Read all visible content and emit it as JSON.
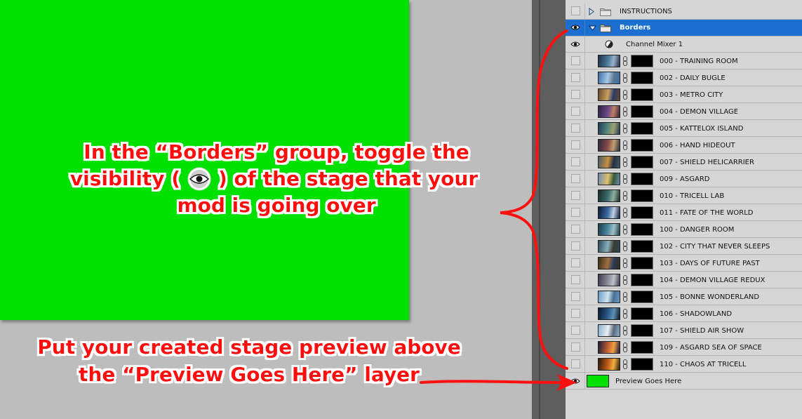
{
  "layers_panel": {
    "groups": [
      {
        "label": "INSTRUCTIONS",
        "expanded": false,
        "visible": false
      },
      {
        "label": "Borders",
        "expanded": true,
        "visible": true,
        "selected": true
      }
    ],
    "adjustment_layer": {
      "label": "Channel Mixer 1",
      "visible": true
    },
    "stage_layers": [
      {
        "label": "000 - TRAINING ROOM",
        "thumb_colors": [
          "#203048",
          "#4a7a9a",
          "#9ab0c8"
        ]
      },
      {
        "label": "002 - DAILY BUGLE",
        "thumb_colors": [
          "#3a6ea8",
          "#a6c8e6",
          "#5a7890"
        ]
      },
      {
        "label": "003 - METRO CITY",
        "thumb_colors": [
          "#6a4a2a",
          "#c8a060",
          "#2a3a6a"
        ]
      },
      {
        "label": "004 - DEMON VILLAGE",
        "thumb_colors": [
          "#302040",
          "#6a4a8a",
          "#c08060"
        ]
      },
      {
        "label": "005 - KATTELOX ISLAND",
        "thumb_colors": [
          "#1a3a5a",
          "#5a8a7a",
          "#a0a070"
        ]
      },
      {
        "label": "006 - HAND HIDEOUT",
        "thumb_colors": [
          "#2a2a3a",
          "#8a4a4a",
          "#c0a070"
        ]
      },
      {
        "label": "007 - SHIELD HELICARRIER",
        "thumb_colors": [
          "#4a5a6a",
          "#c89040",
          "#203040"
        ]
      },
      {
        "label": "009 - ASGARD",
        "thumb_colors": [
          "#6a8ab0",
          "#e0c070",
          "#3a5a3a"
        ]
      },
      {
        "label": "010 - TRICELL LAB",
        "thumb_colors": [
          "#1a2a2a",
          "#3a6a6a",
          "#90b0a0"
        ]
      },
      {
        "label": "011 - FATE OF THE WORLD",
        "thumb_colors": [
          "#0a1a3a",
          "#3a6aa0",
          "#c0d0e0"
        ]
      },
      {
        "label": "100 - DANGER ROOM",
        "thumb_colors": [
          "#1a3a4a",
          "#4a8aa0",
          "#a0c0c8"
        ]
      },
      {
        "label": "102 - CITY THAT NEVER SLEEPS",
        "thumb_colors": [
          "#2a4a5a",
          "#8ab0c0",
          "#3a3a2a"
        ]
      },
      {
        "label": "103 - DAYS OF FUTURE PAST",
        "thumb_colors": [
          "#3a2a1a",
          "#a07040",
          "#2a3a5a"
        ]
      },
      {
        "label": "104 - DEMON VILLAGE REDUX",
        "thumb_colors": [
          "#3a3a4a",
          "#8a8a9a",
          "#c0c0c8"
        ]
      },
      {
        "label": "105 - BONNE WONDERLAND",
        "thumb_colors": [
          "#6a9ac8",
          "#d0e4f0",
          "#4a7090"
        ]
      },
      {
        "label": "106 - SHADOWLAND",
        "thumb_colors": [
          "#0a1a2a",
          "#2a5a8a",
          "#6090b0"
        ]
      },
      {
        "label": "107 - SHIELD AIR SHOW",
        "thumb_colors": [
          "#8ab0d0",
          "#e8eef4",
          "#5a6a7a"
        ]
      },
      {
        "label": "109 - ASGARD SEA OF SPACE",
        "thumb_colors": [
          "#1a1a3a",
          "#c06030",
          "#f0a040"
        ]
      },
      {
        "label": "110 - CHAOS AT TRICELL",
        "thumb_colors": [
          "#2a1a0a",
          "#c05a1a",
          "#f0b040"
        ]
      }
    ],
    "preview_layer": {
      "label": "Preview Goes Here",
      "visible": true,
      "thumb_color": "#00e100"
    }
  },
  "annotations": {
    "instruction_1_line_1": "In the “Borders” group, toggle the",
    "instruction_1_line_2a": "visibility (",
    "instruction_1_line_2b": ") of the stage that your",
    "instruction_1_line_3": "mod is going over",
    "instruction_2_line_1": "Put your created stage preview above",
    "instruction_2_line_2": "the “Preview Goes Here” layer"
  },
  "colors": {
    "canvas_green": "#00e100",
    "annotation_red": "#ff1010",
    "selection_blue": "#1a6fd0",
    "panel_bg": "#d6d6d6",
    "workspace_gray": "#bdbdbd"
  }
}
